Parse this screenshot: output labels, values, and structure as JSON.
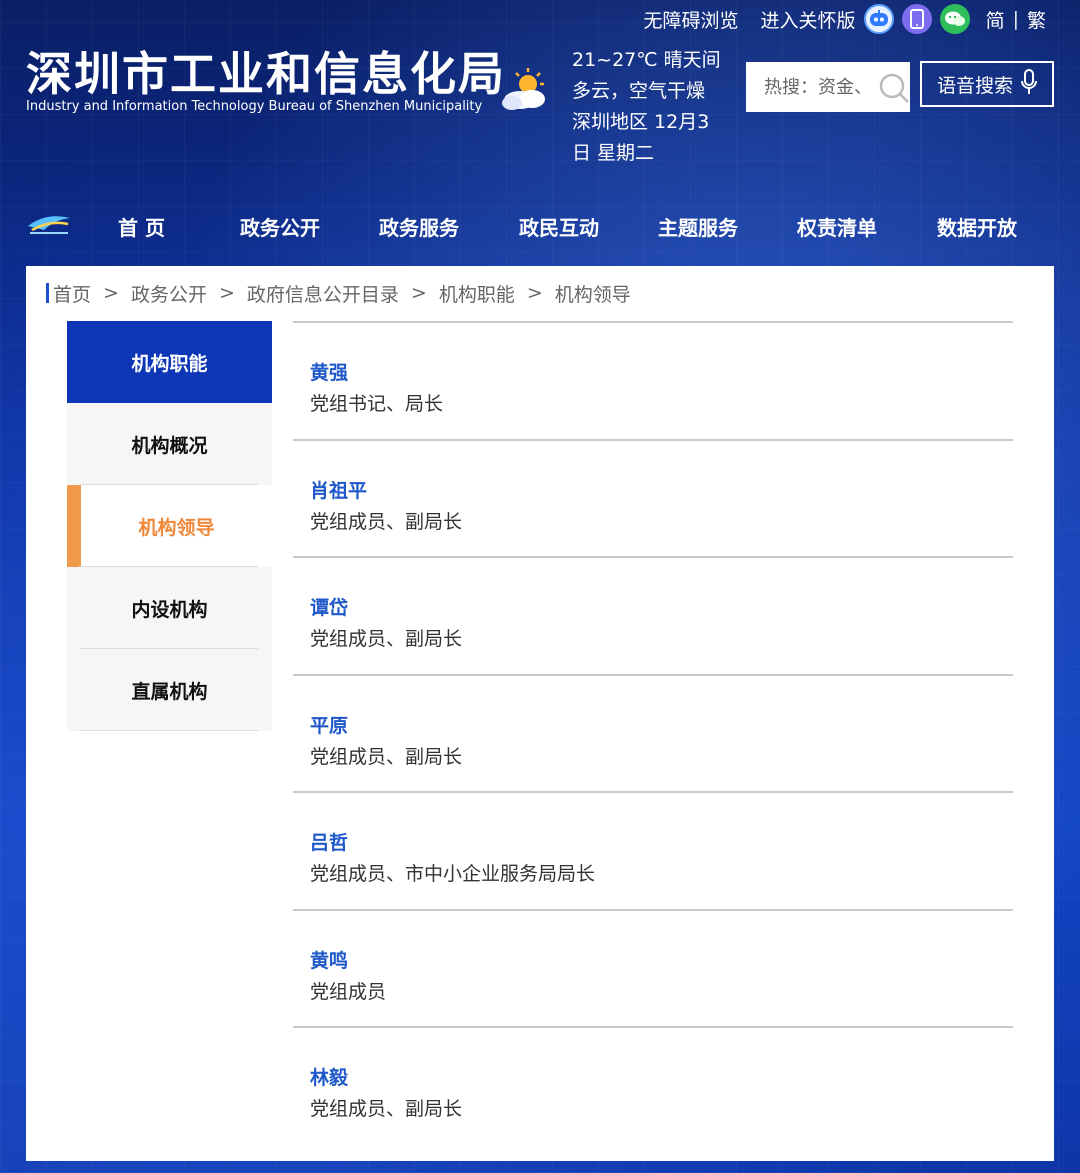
{
  "header": {
    "top_links": {
      "accessible": "无障碍浏览",
      "care_mode": "进入关怀版"
    },
    "lang": {
      "simplified": "简",
      "separator": "|",
      "traditional": "繁"
    },
    "title_cn": "深圳市工业和信息化局",
    "title_en": "Industry and Information Technology Bureau of Shenzhen Municipality",
    "weather": {
      "line1": "21~27℃ 晴天间",
      "line2": "多云，空气干燥",
      "line3": "深圳地区 12月3",
      "line4": "日  星期二"
    },
    "search": {
      "placeholder": "热搜：资金、"
    },
    "voice_search": "语音搜索"
  },
  "nav": {
    "items": [
      "首 页",
      "政务公开",
      "政务服务",
      "政民互动",
      "主题服务",
      "权责清单",
      "数据开放"
    ]
  },
  "breadcrumb": [
    "首页",
    "政务公开",
    "政府信息公开目录",
    "机构职能",
    "机构领导"
  ],
  "breadcrumb_separator": ">",
  "sidebar": {
    "heading": "机构职能",
    "items": [
      "机构概况",
      "机构领导",
      "内设机构",
      "直属机构"
    ],
    "active_index": 1
  },
  "leaders": [
    {
      "name": "黄强",
      "title": "党组书记、局长"
    },
    {
      "name": "肖祖平",
      "title": "党组成员、副局长"
    },
    {
      "name": "谭岱",
      "title": "党组成员、副局长"
    },
    {
      "name": "平原",
      "title": "党组成员、副局长"
    },
    {
      "name": "吕哲",
      "title": "党组成员、市中小企业服务局局长"
    },
    {
      "name": "黄鸣",
      "title": "党组成员"
    },
    {
      "name": "林毅",
      "title": "党组成员、副局长"
    }
  ],
  "colors": {
    "brand_blue": "#0e37b8",
    "link_blue": "#1f58c8",
    "active_orange": "#f0883a"
  }
}
